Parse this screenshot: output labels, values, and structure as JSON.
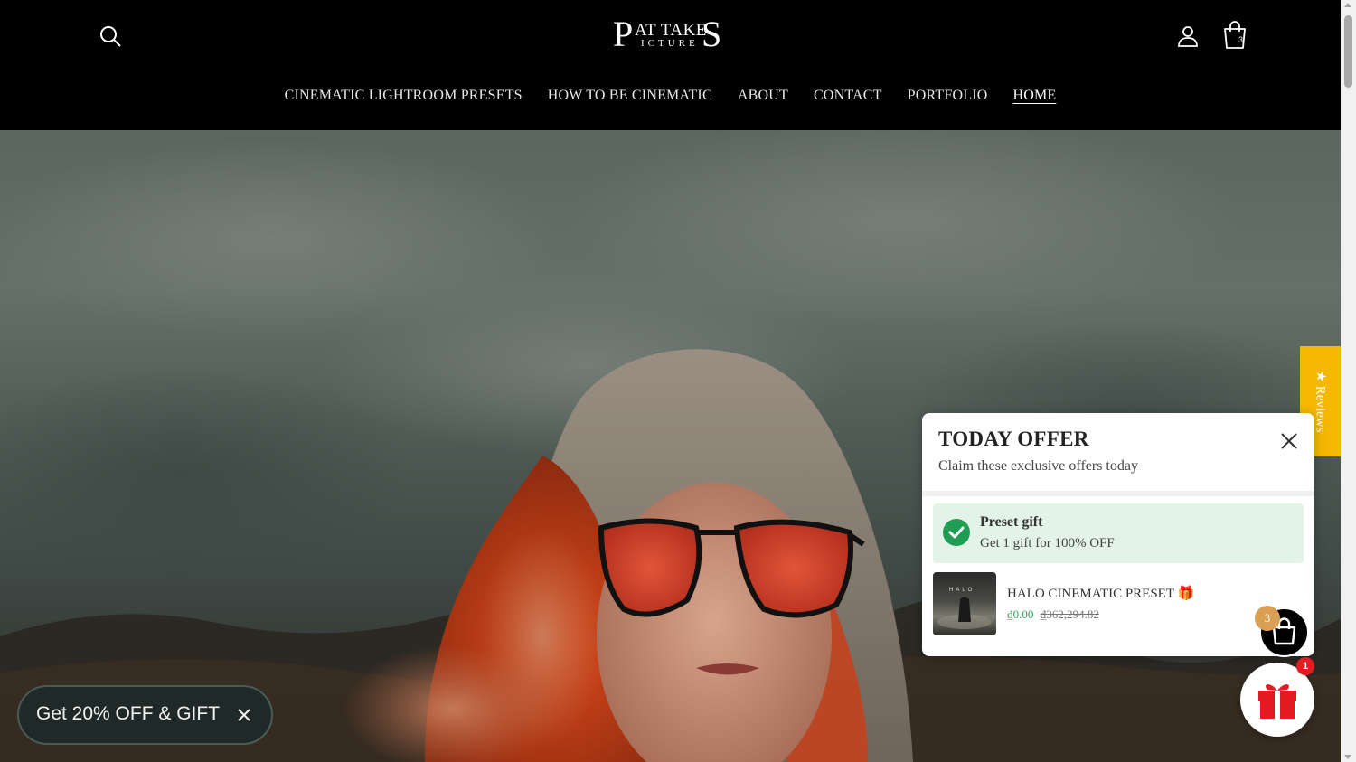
{
  "header": {
    "logo": {
      "big_p": "P",
      "top": "AT TAKE",
      "bottom": "ICTURE",
      "big_s": "S"
    },
    "cart_count": "3"
  },
  "nav": {
    "items": [
      {
        "label": "CINEMATIC LIGHTROOM PRESETS"
      },
      {
        "label": "HOW TO BE CINEMATIC"
      },
      {
        "label": "ABOUT"
      },
      {
        "label": "CONTACT"
      },
      {
        "label": "PORTFOLIO"
      },
      {
        "label": "HOME",
        "active": true
      }
    ]
  },
  "reviews_tab": {
    "label": "★ Reviews"
  },
  "offer": {
    "title": "TODAY OFFER",
    "subtitle": "Claim these exclusive offers today",
    "gift": {
      "title": "Preset gift",
      "description": "Get 1 gift for 100% OFF"
    },
    "product": {
      "name": "HALO CINEMATIC PRESET 🎁",
      "thumb_label": "HALO",
      "price": "₫0.00",
      "original_price": "₫362,294.82"
    }
  },
  "float_cart": {
    "badge": "3"
  },
  "gift_button": {
    "badge": "1"
  },
  "promo": {
    "text": "Get 20% OFF & GIFT"
  },
  "colors": {
    "accent_yellow": "#f5b800",
    "success_green": "#1f9d55",
    "gift_red": "#e41b23"
  }
}
